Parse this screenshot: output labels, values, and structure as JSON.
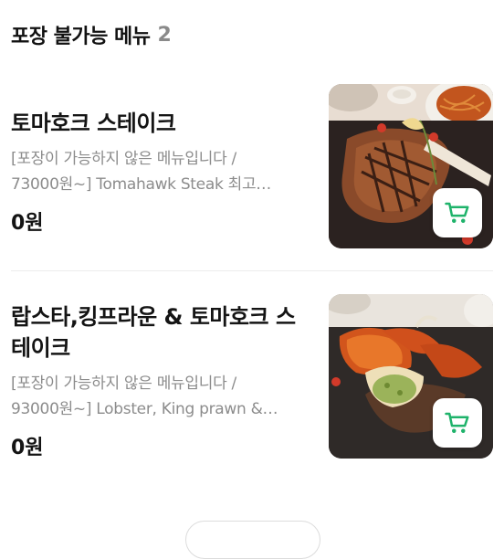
{
  "section": {
    "title": "포장 불가능 메뉴",
    "count": "2"
  },
  "items": [
    {
      "name": "토마호크 스테이크",
      "desc_lines": [
        "[포장이 가능하지 않은 메뉴입니다 /",
        "73000원~] Tomahawk Steak 최고…"
      ],
      "price": "0원",
      "image_icon": "tomahawk-steak-photo",
      "cart_icon": "cart-icon"
    },
    {
      "name": "랍스타,킹프라운 & 토마호크 스테이크",
      "desc_lines": [
        "[포장이 가능하지 않은 메뉴입니다 /",
        "93000원~] Lobster, King prawn &…"
      ],
      "price": "0원",
      "image_icon": "lobster-steak-photo",
      "cart_icon": "cart-icon"
    }
  ],
  "colors": {
    "accent": "#1fb36b",
    "muted": "#8c8c8c",
    "text": "#141414",
    "divider": "#ececec"
  }
}
